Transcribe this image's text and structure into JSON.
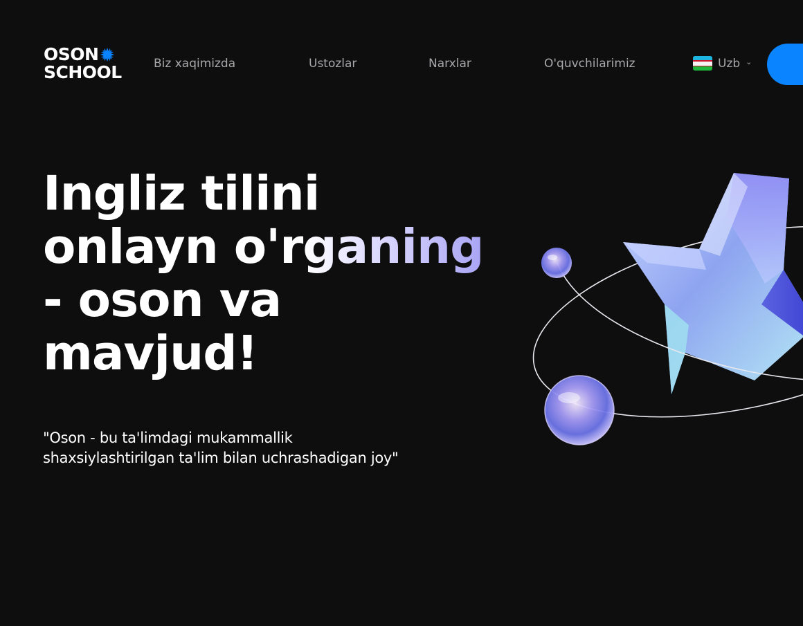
{
  "brand": {
    "logo_line1": "OSON",
    "logo_line2": "SCHOOL",
    "accent": "#0a84ff"
  },
  "nav": {
    "items": [
      {
        "label": "Biz xaqimizda"
      },
      {
        "label": "Ustozlar"
      },
      {
        "label": "Narxlar"
      },
      {
        "label": "O'quvchilarimiz"
      }
    ]
  },
  "language": {
    "label": "Uzb",
    "flag_icon": "uzbekistan-flag-icon",
    "chevron_icon": "chevron-down-icon"
  },
  "cta": {
    "label": "",
    "color": "#0a84ff"
  },
  "hero": {
    "title_line1": "Ingliz tilini",
    "title_line2a": "onlayn o'r",
    "title_line2b": "ganing",
    "title_line3": "- oson va",
    "title_line4": "mavjud!",
    "quote_line1": "\"Oson - bu ta'limdagi mukammallik",
    "quote_line2": "shaxsiylashtirilgan ta'lim bilan uchrashadigan joy\""
  },
  "colors": {
    "background": "#0e0e0f",
    "nav_text": "#a8a8ab",
    "gradient_end": "#a9a4f4"
  }
}
